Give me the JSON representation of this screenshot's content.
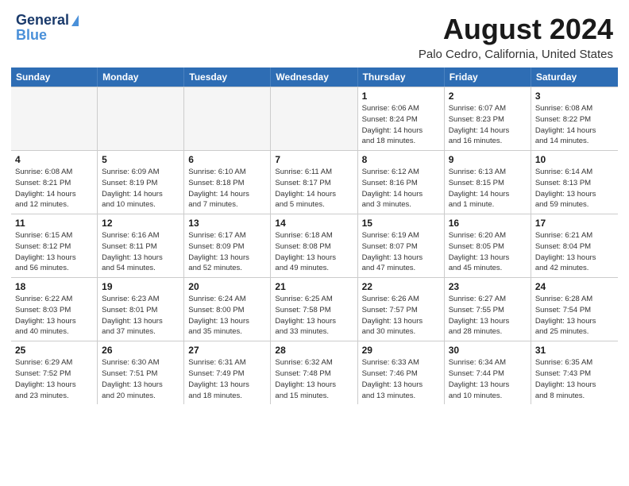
{
  "header": {
    "logo_line1": "General",
    "logo_line2": "Blue",
    "title": "August 2024",
    "subtitle": "Palo Cedro, California, United States"
  },
  "days_of_week": [
    "Sunday",
    "Monday",
    "Tuesday",
    "Wednesday",
    "Thursday",
    "Friday",
    "Saturday"
  ],
  "weeks": [
    [
      {
        "day": "",
        "info": ""
      },
      {
        "day": "",
        "info": ""
      },
      {
        "day": "",
        "info": ""
      },
      {
        "day": "",
        "info": ""
      },
      {
        "day": "1",
        "info": "Sunrise: 6:06 AM\nSunset: 8:24 PM\nDaylight: 14 hours\nand 18 minutes."
      },
      {
        "day": "2",
        "info": "Sunrise: 6:07 AM\nSunset: 8:23 PM\nDaylight: 14 hours\nand 16 minutes."
      },
      {
        "day": "3",
        "info": "Sunrise: 6:08 AM\nSunset: 8:22 PM\nDaylight: 14 hours\nand 14 minutes."
      }
    ],
    [
      {
        "day": "4",
        "info": "Sunrise: 6:08 AM\nSunset: 8:21 PM\nDaylight: 14 hours\nand 12 minutes."
      },
      {
        "day": "5",
        "info": "Sunrise: 6:09 AM\nSunset: 8:19 PM\nDaylight: 14 hours\nand 10 minutes."
      },
      {
        "day": "6",
        "info": "Sunrise: 6:10 AM\nSunset: 8:18 PM\nDaylight: 14 hours\nand 7 minutes."
      },
      {
        "day": "7",
        "info": "Sunrise: 6:11 AM\nSunset: 8:17 PM\nDaylight: 14 hours\nand 5 minutes."
      },
      {
        "day": "8",
        "info": "Sunrise: 6:12 AM\nSunset: 8:16 PM\nDaylight: 14 hours\nand 3 minutes."
      },
      {
        "day": "9",
        "info": "Sunrise: 6:13 AM\nSunset: 8:15 PM\nDaylight: 14 hours\nand 1 minute."
      },
      {
        "day": "10",
        "info": "Sunrise: 6:14 AM\nSunset: 8:13 PM\nDaylight: 13 hours\nand 59 minutes."
      }
    ],
    [
      {
        "day": "11",
        "info": "Sunrise: 6:15 AM\nSunset: 8:12 PM\nDaylight: 13 hours\nand 56 minutes."
      },
      {
        "day": "12",
        "info": "Sunrise: 6:16 AM\nSunset: 8:11 PM\nDaylight: 13 hours\nand 54 minutes."
      },
      {
        "day": "13",
        "info": "Sunrise: 6:17 AM\nSunset: 8:09 PM\nDaylight: 13 hours\nand 52 minutes."
      },
      {
        "day": "14",
        "info": "Sunrise: 6:18 AM\nSunset: 8:08 PM\nDaylight: 13 hours\nand 49 minutes."
      },
      {
        "day": "15",
        "info": "Sunrise: 6:19 AM\nSunset: 8:07 PM\nDaylight: 13 hours\nand 47 minutes."
      },
      {
        "day": "16",
        "info": "Sunrise: 6:20 AM\nSunset: 8:05 PM\nDaylight: 13 hours\nand 45 minutes."
      },
      {
        "day": "17",
        "info": "Sunrise: 6:21 AM\nSunset: 8:04 PM\nDaylight: 13 hours\nand 42 minutes."
      }
    ],
    [
      {
        "day": "18",
        "info": "Sunrise: 6:22 AM\nSunset: 8:03 PM\nDaylight: 13 hours\nand 40 minutes."
      },
      {
        "day": "19",
        "info": "Sunrise: 6:23 AM\nSunset: 8:01 PM\nDaylight: 13 hours\nand 37 minutes."
      },
      {
        "day": "20",
        "info": "Sunrise: 6:24 AM\nSunset: 8:00 PM\nDaylight: 13 hours\nand 35 minutes."
      },
      {
        "day": "21",
        "info": "Sunrise: 6:25 AM\nSunset: 7:58 PM\nDaylight: 13 hours\nand 33 minutes."
      },
      {
        "day": "22",
        "info": "Sunrise: 6:26 AM\nSunset: 7:57 PM\nDaylight: 13 hours\nand 30 minutes."
      },
      {
        "day": "23",
        "info": "Sunrise: 6:27 AM\nSunset: 7:55 PM\nDaylight: 13 hours\nand 28 minutes."
      },
      {
        "day": "24",
        "info": "Sunrise: 6:28 AM\nSunset: 7:54 PM\nDaylight: 13 hours\nand 25 minutes."
      }
    ],
    [
      {
        "day": "25",
        "info": "Sunrise: 6:29 AM\nSunset: 7:52 PM\nDaylight: 13 hours\nand 23 minutes."
      },
      {
        "day": "26",
        "info": "Sunrise: 6:30 AM\nSunset: 7:51 PM\nDaylight: 13 hours\nand 20 minutes."
      },
      {
        "day": "27",
        "info": "Sunrise: 6:31 AM\nSunset: 7:49 PM\nDaylight: 13 hours\nand 18 minutes."
      },
      {
        "day": "28",
        "info": "Sunrise: 6:32 AM\nSunset: 7:48 PM\nDaylight: 13 hours\nand 15 minutes."
      },
      {
        "day": "29",
        "info": "Sunrise: 6:33 AM\nSunset: 7:46 PM\nDaylight: 13 hours\nand 13 minutes."
      },
      {
        "day": "30",
        "info": "Sunrise: 6:34 AM\nSunset: 7:44 PM\nDaylight: 13 hours\nand 10 minutes."
      },
      {
        "day": "31",
        "info": "Sunrise: 6:35 AM\nSunset: 7:43 PM\nDaylight: 13 hours\nand 8 minutes."
      }
    ]
  ]
}
